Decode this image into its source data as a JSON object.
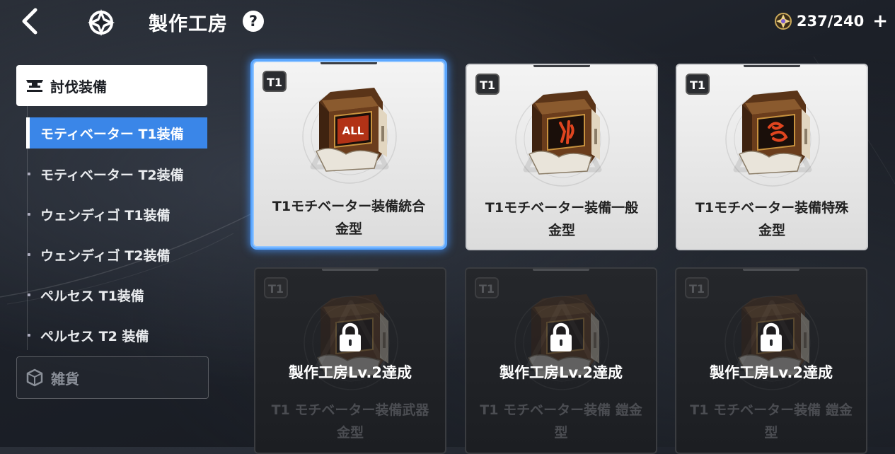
{
  "header": {
    "title": "製作工房",
    "help_label": "?",
    "currency": "237/240",
    "plus_label": "+"
  },
  "sidebar": {
    "category": "討伐装備",
    "items": [
      {
        "label": "モティベーター T1装備",
        "active": true
      },
      {
        "label": "モティベーター T2装備",
        "active": false
      },
      {
        "label": "ウェンディゴ T1装備",
        "active": false
      },
      {
        "label": "ウェンディゴ T2装備",
        "active": false
      },
      {
        "label": "ペルセス T1装備",
        "active": false
      },
      {
        "label": "ペルセス T2 装備",
        "active": false
      }
    ],
    "collapsed_category": "雑貨"
  },
  "cards": [
    {
      "tier": "T1",
      "line1": "T1モチベーター装備統合",
      "line2": "金型",
      "badge_text": "ALL",
      "locked": false,
      "selected": true
    },
    {
      "tier": "T1",
      "line1": "T1モチベーター装備一般",
      "line2": "金型",
      "locked": false,
      "selected": false
    },
    {
      "tier": "T1",
      "line1": "T1モチベーター装備特殊",
      "line2": "金型",
      "locked": false,
      "selected": false
    },
    {
      "tier": "T1",
      "line1": "T1 モチベーター装備武器",
      "line2": "金型",
      "lock_text": "製作工房Lv.2達成",
      "locked": true
    },
    {
      "tier": "T1",
      "line1": "T1 モチベーター装備 鎧金",
      "line2": "型",
      "lock_text": "製作工房Lv.2達成",
      "locked": true
    },
    {
      "tier": "T1",
      "line1": "T1 モチベーター装備 鎧金",
      "line2": "型",
      "lock_text": "製作工房Lv.2達成",
      "locked": true
    }
  ],
  "colors": {
    "accent": "#3a86e8",
    "selected_glow": "#5aa6ff"
  },
  "icons": {
    "back": "chevron-left-icon",
    "logo": "star-emblem-icon",
    "currency": "energy-icon",
    "category": "anvil-icon",
    "collapsed_category": "box-icon",
    "lock": "lock-icon"
  }
}
